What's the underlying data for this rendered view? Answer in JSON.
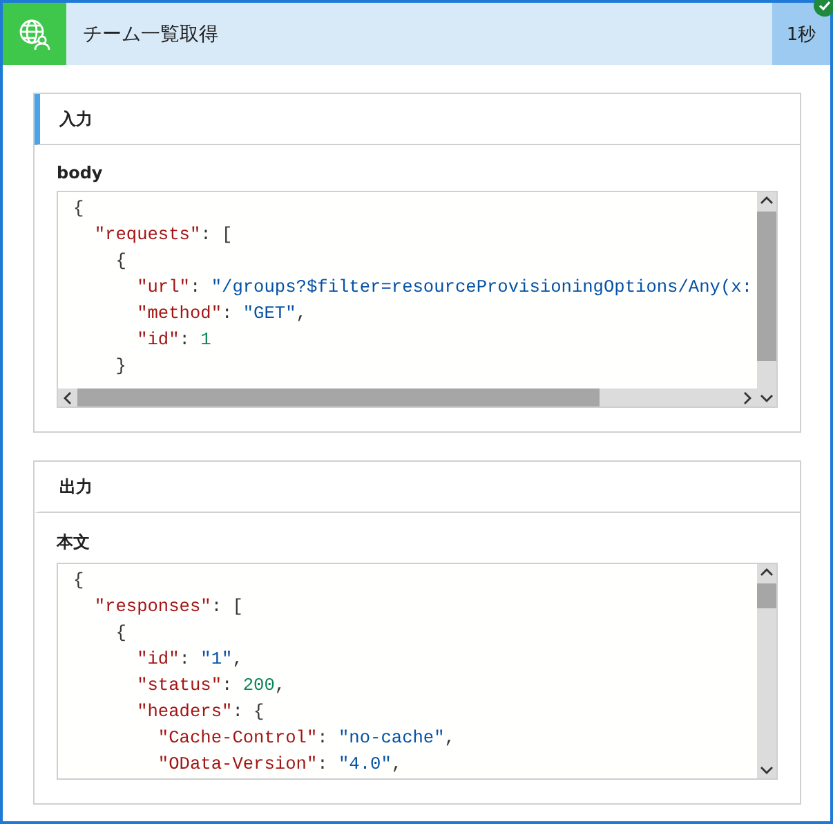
{
  "action": {
    "title": "チーム一覧取得",
    "duration": "1秒",
    "succeeded": true
  },
  "sections": [
    {
      "heading": "入力",
      "field_label": "body",
      "horizontal_scrollbar": true,
      "code": [
        {
          "tokens": [
            {
              "kind": "punct",
              "text": "{"
            }
          ]
        },
        {
          "tokens": [
            {
              "kind": "key",
              "text": "  \"requests\""
            },
            {
              "kind": "punct",
              "text": ": ["
            }
          ]
        },
        {
          "tokens": [
            {
              "kind": "punct",
              "text": "    {"
            }
          ]
        },
        {
          "tokens": [
            {
              "kind": "key",
              "text": "      \"url\""
            },
            {
              "kind": "punct",
              "text": ": "
            },
            {
              "kind": "str",
              "text": "\"/groups?$filter=resourceProvisioningOptions/Any(x:"
            }
          ]
        },
        {
          "tokens": [
            {
              "kind": "key",
              "text": "      \"method\""
            },
            {
              "kind": "punct",
              "text": ": "
            },
            {
              "kind": "str",
              "text": "\"GET\""
            },
            {
              "kind": "punct",
              "text": ","
            }
          ]
        },
        {
          "tokens": [
            {
              "kind": "key",
              "text": "      \"id\""
            },
            {
              "kind": "punct",
              "text": ": "
            },
            {
              "kind": "num",
              "text": "1"
            }
          ]
        },
        {
          "tokens": [
            {
              "kind": "punct",
              "text": "    }"
            }
          ]
        }
      ]
    },
    {
      "heading": "出力",
      "field_label": "本文",
      "horizontal_scrollbar": false,
      "code": [
        {
          "tokens": [
            {
              "kind": "punct",
              "text": "{"
            }
          ]
        },
        {
          "tokens": [
            {
              "kind": "key",
              "text": "  \"responses\""
            },
            {
              "kind": "punct",
              "text": ": ["
            }
          ]
        },
        {
          "tokens": [
            {
              "kind": "punct",
              "text": "    {"
            }
          ]
        },
        {
          "tokens": [
            {
              "kind": "key",
              "text": "      \"id\""
            },
            {
              "kind": "punct",
              "text": ": "
            },
            {
              "kind": "str",
              "text": "\"1\""
            },
            {
              "kind": "punct",
              "text": ","
            }
          ]
        },
        {
          "tokens": [
            {
              "kind": "key",
              "text": "      \"status\""
            },
            {
              "kind": "punct",
              "text": ": "
            },
            {
              "kind": "num",
              "text": "200"
            },
            {
              "kind": "punct",
              "text": ","
            }
          ]
        },
        {
          "tokens": [
            {
              "kind": "key",
              "text": "      \"headers\""
            },
            {
              "kind": "punct",
              "text": ": {"
            }
          ]
        },
        {
          "tokens": [
            {
              "kind": "key",
              "text": "        \"Cache-Control\""
            },
            {
              "kind": "punct",
              "text": ": "
            },
            {
              "kind": "str",
              "text": "\"no-cache\""
            },
            {
              "kind": "punct",
              "text": ","
            }
          ]
        },
        {
          "tokens": [
            {
              "kind": "key",
              "text": "        \"OData-Version\""
            },
            {
              "kind": "punct",
              "text": ": "
            },
            {
              "kind": "str",
              "text": "\"4.0\""
            },
            {
              "kind": "punct",
              "text": ","
            }
          ]
        }
      ]
    }
  ]
}
